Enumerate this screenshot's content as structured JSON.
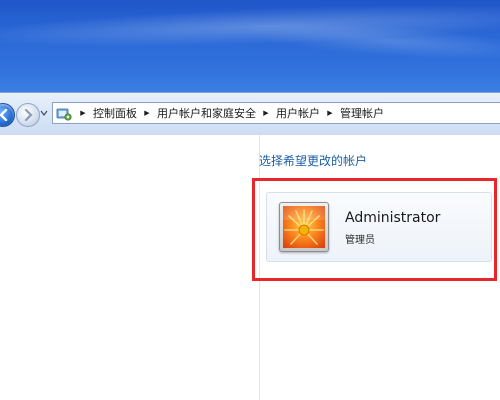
{
  "window": {
    "accent_color": "#2a67d6"
  },
  "navigation": {
    "back_icon": "back-arrow-icon",
    "forward_icon": "forward-arrow-icon",
    "address_icon": "control-panel-icon",
    "breadcrumbs": [
      "控制面板",
      "用户帐户和家庭安全",
      "用户帐户",
      "管理帐户"
    ]
  },
  "main": {
    "heading": "选择希望更改的帐户",
    "accounts": [
      {
        "name": "Administrator",
        "role": "管理员",
        "avatar_icon": "flower-avatar-icon"
      }
    ],
    "highlight_color": "#e8262b"
  }
}
